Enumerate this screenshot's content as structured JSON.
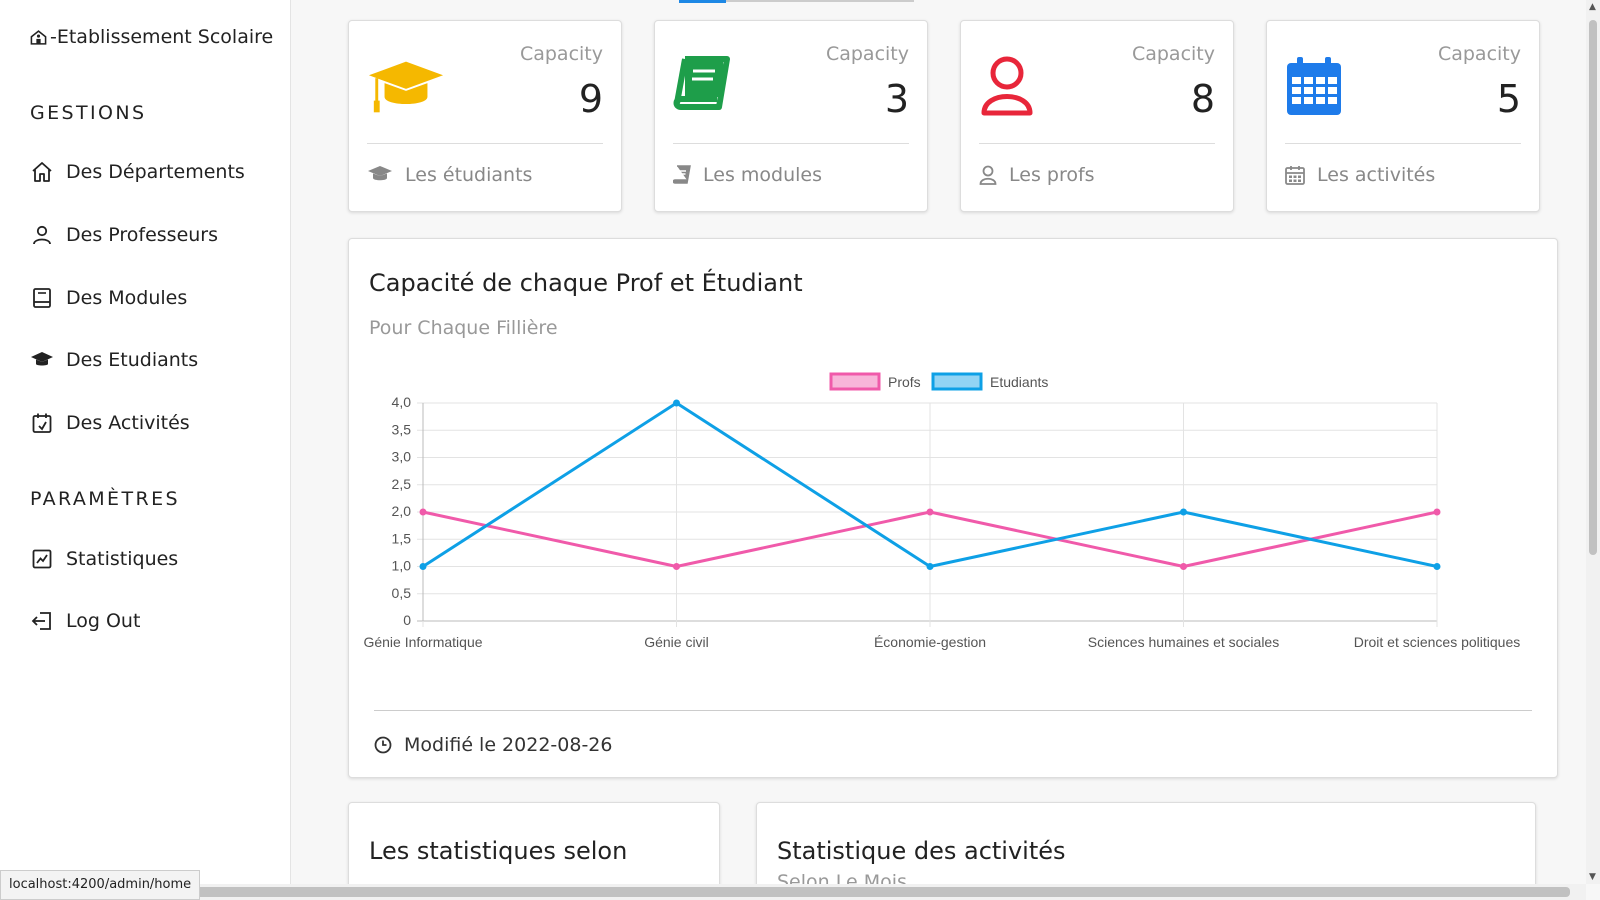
{
  "sidebar": {
    "brand": "-Etablissement Scolaire",
    "sections": [
      {
        "title": "GESTIONS"
      },
      {
        "title": "PARAMÈTRES"
      }
    ],
    "items": [
      {
        "label": "Des Départements",
        "icon": "home-icon"
      },
      {
        "label": "Des Professeurs",
        "icon": "user-icon"
      },
      {
        "label": "Des Modules",
        "icon": "book-icon"
      },
      {
        "label": "Des Etudiants",
        "icon": "graduation-cap-icon"
      },
      {
        "label": "Des Activités",
        "icon": "calendar-check-icon"
      },
      {
        "label": "Statistiques",
        "icon": "chart-line-icon"
      },
      {
        "label": "Log Out",
        "icon": "logout-icon"
      }
    ]
  },
  "cards": [
    {
      "capacity_label": "Capacity",
      "value": "9",
      "footer": "Les étudiants",
      "color": "#f5b800",
      "icon": "graduation-cap-icon"
    },
    {
      "capacity_label": "Capacity",
      "value": "3",
      "footer": "Les modules",
      "color": "#1e9e4a",
      "icon": "book-icon"
    },
    {
      "capacity_label": "Capacity",
      "value": "8",
      "footer": "Les profs",
      "color": "#e8263a",
      "icon": "user-icon"
    },
    {
      "capacity_label": "Capacity",
      "value": "5",
      "footer": "Les activités",
      "color": "#1e7bea",
      "icon": "calendar-icon"
    }
  ],
  "chart_panel": {
    "title": "Capacité de chaque Prof et Étudiant",
    "subtitle": "Pour Chaque Fillière",
    "footer": "Modifié le 2022-08-26"
  },
  "chart_data": {
    "type": "line",
    "categories": [
      "Génie Informatique",
      "Génie civil",
      "Économie-gestion",
      "Sciences humaines et sociales",
      "Droit et sciences politiques"
    ],
    "series": [
      {
        "name": "Profs",
        "values": [
          2,
          1,
          2,
          1,
          2
        ],
        "color": "#f05aaa"
      },
      {
        "name": "Etudiants",
        "values": [
          1,
          4,
          1,
          2,
          1
        ],
        "color": "#0ea0e6"
      }
    ],
    "yticks": [
      "0",
      "0,5",
      "1,0",
      "1,5",
      "2,0",
      "2,5",
      "3,0",
      "3,5",
      "4,0"
    ],
    "ylim": [
      0,
      4
    ],
    "grid": true,
    "legend": "top"
  },
  "bottom_cards": [
    {
      "title": "Les statistiques selon",
      "subtitle": ""
    },
    {
      "title": "Statistique des activités",
      "subtitle": "Selon Le Mois"
    }
  ],
  "status_url": "localhost:4200/admin/home"
}
